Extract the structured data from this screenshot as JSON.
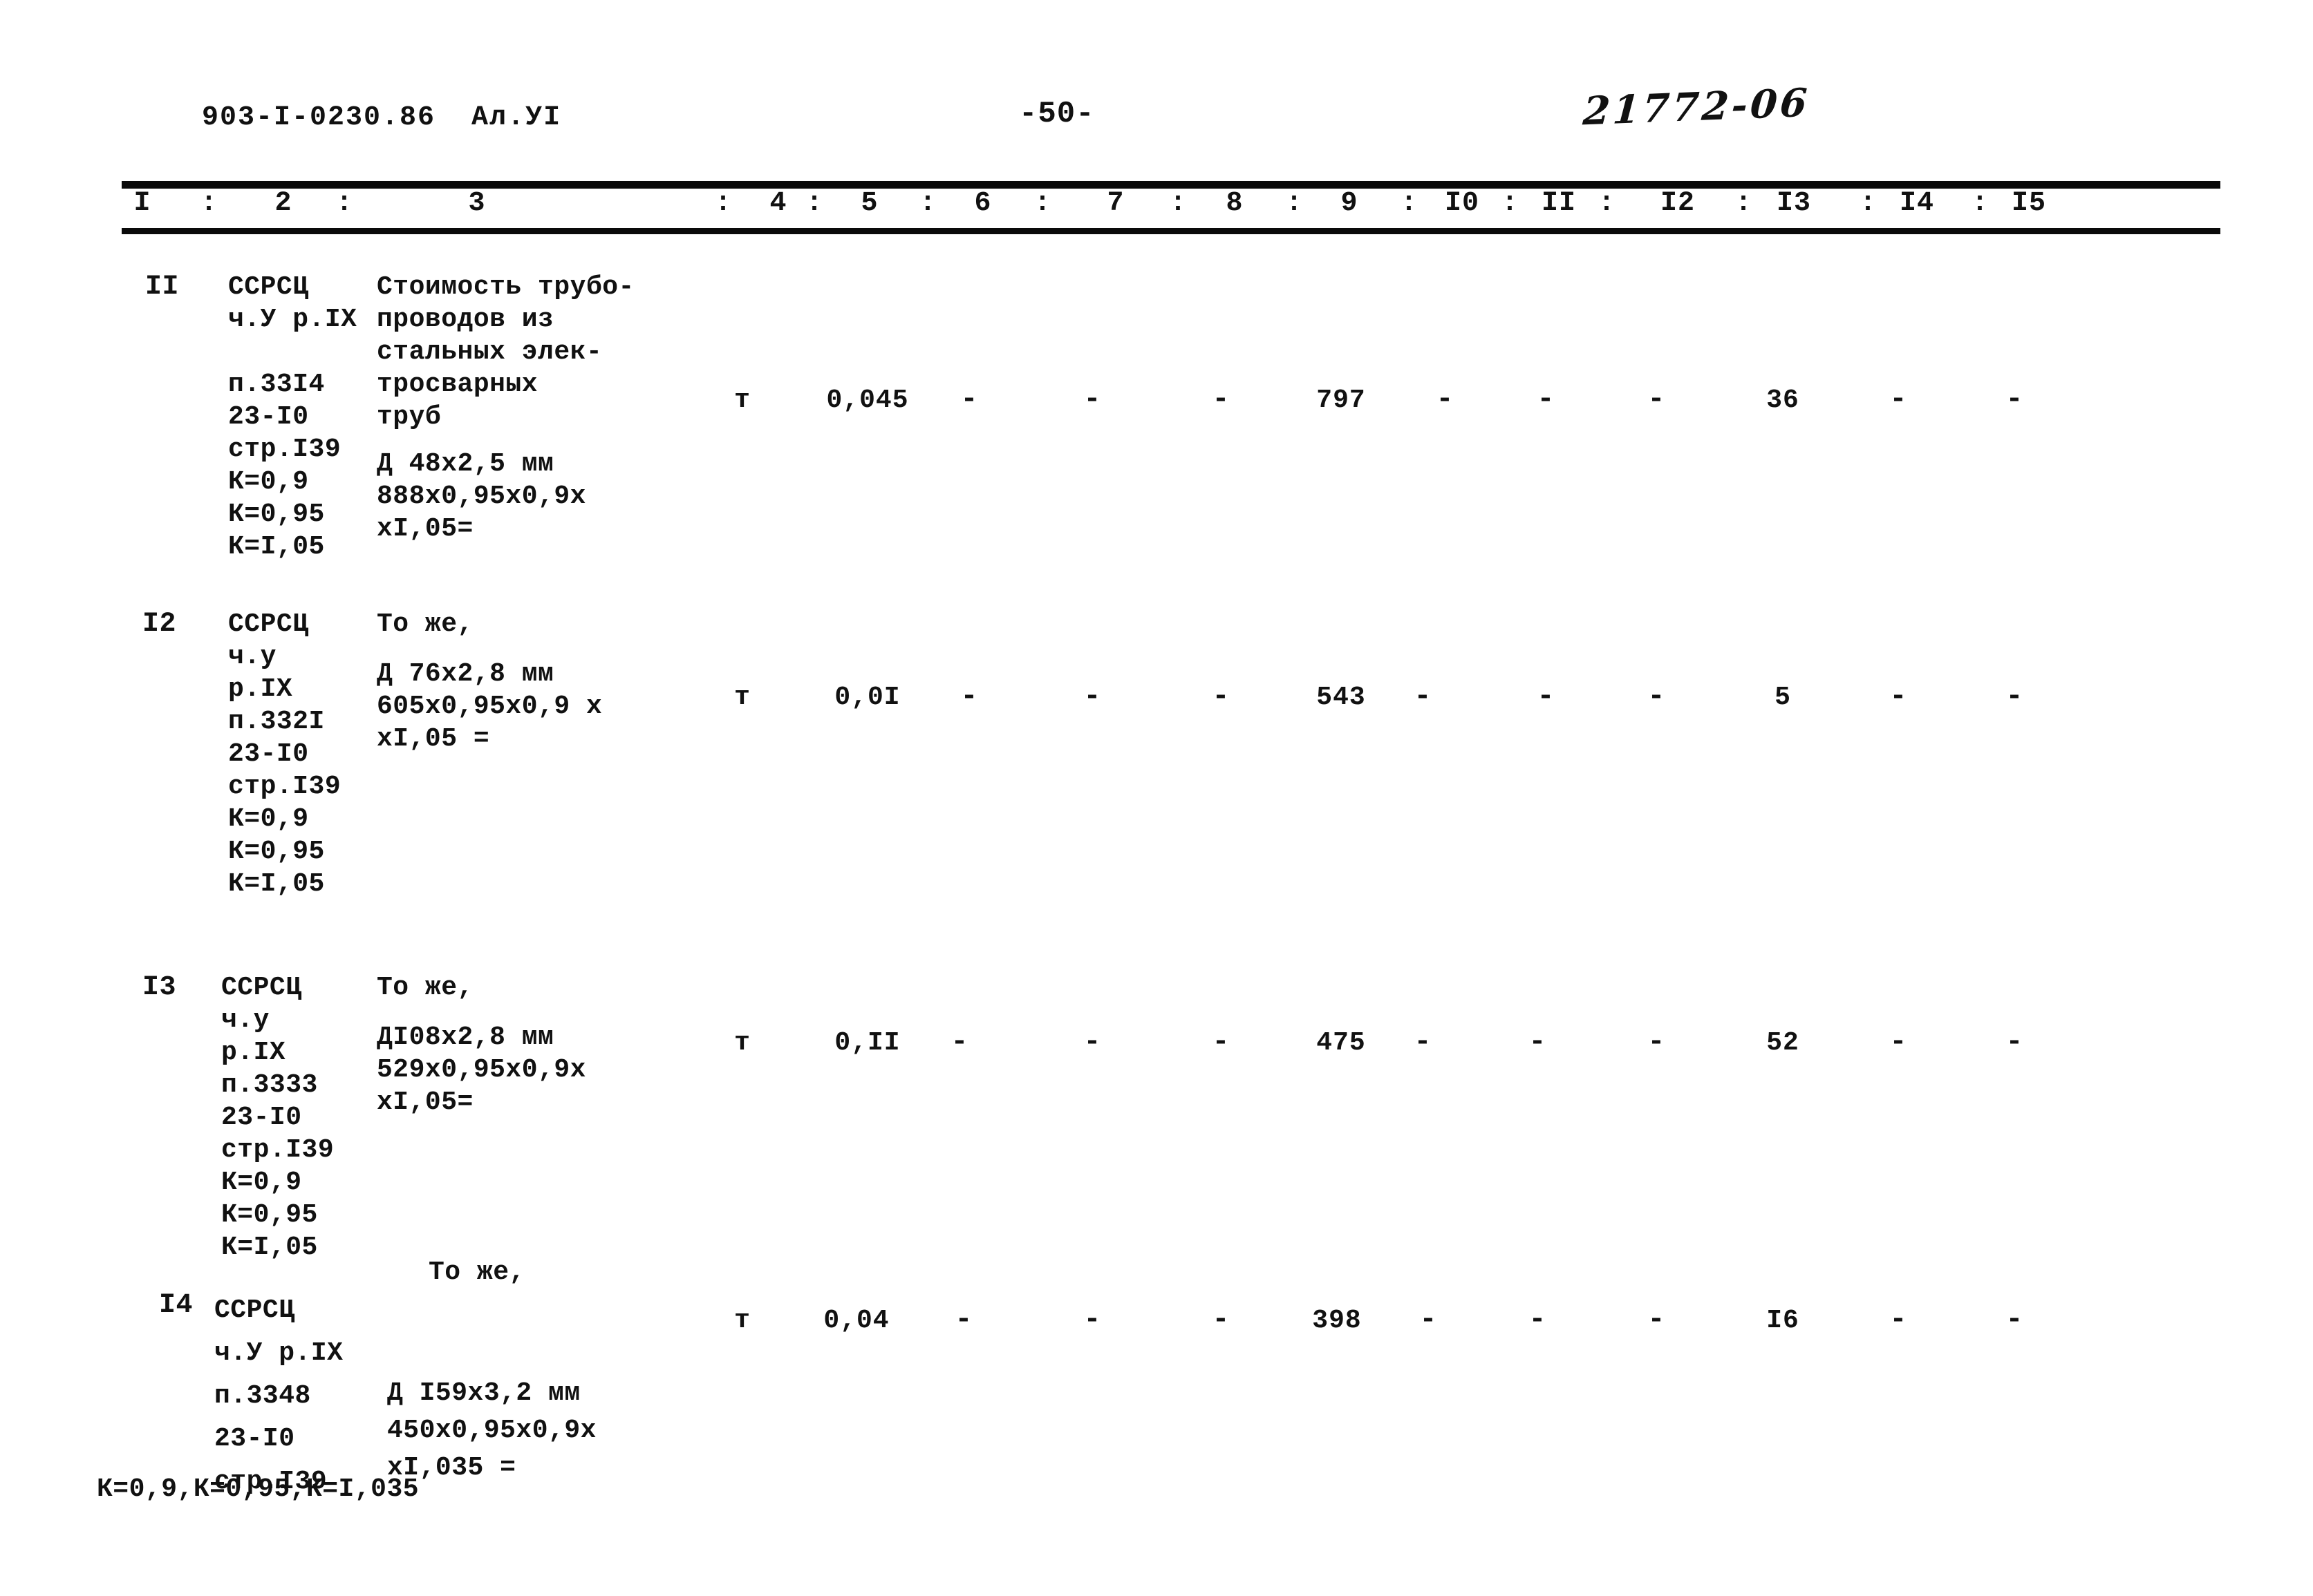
{
  "header": {
    "doc_code": "903-I-0230.86  Ал.УI",
    "page_number": "-50-",
    "handwritten_note": "21772-06"
  },
  "table": {
    "column_headers": [
      "I",
      "2",
      "3",
      "4",
      "5",
      "6",
      "7",
      "8",
      "9",
      "I0",
      "II",
      "I2",
      "I3",
      "I4",
      "I5"
    ],
    "separator": ":",
    "rows": [
      {
        "pos": "II",
        "justification": "ССРСЦ\nч.У р.IX\n\nп.33I4\n23-I0\nстр.I39\nК=0,9\nК=0,95\nК=I,05",
        "description_main": "Стоимость трубо-\nпроводов из\nстальных элек-\nтросварных\nтруб",
        "description_calc": "Д 48х2,5 мм\n888х0,95х0,9х\nхI,05=",
        "unit": "т",
        "qty": "0,045",
        "c6": "-",
        "c7": "-",
        "c8": "-",
        "c9": "797",
        "c10": "-",
        "c11": "-",
        "c12": "-",
        "c13": "36",
        "c14": "-",
        "c15": "-"
      },
      {
        "pos": "I2",
        "justification": "ССРСЦ\nч.у\nр.IX\nп.332I\n23-I0\nстр.I39\nК=0,9\nК=0,95\nК=I,05",
        "description_main": "То же,",
        "description_calc": "Д 76х2,8 мм\n605х0,95х0,9 х\nхI,05 =",
        "unit": "т",
        "qty": "0,0I",
        "c6": "-",
        "c7": "-",
        "c8": "-",
        "c9": "543",
        "c10": "-",
        "c11": "-",
        "c12": "-",
        "c13": "5",
        "c14": "-",
        "c15": "-"
      },
      {
        "pos": "I3",
        "justification": "ССРСЦ\nч.у\nр.IX\nп.3333\n23-I0\nстр.I39\nК=0,9\nК=0,95\nК=I,05",
        "description_main": "То же,",
        "description_calc": "ДI08х2,8 мм\n529х0,95х0,9х\nхI,05=",
        "unit": "т",
        "qty": "0,II",
        "c6": "-",
        "c7": "-",
        "c8": "-",
        "c9": "475",
        "c10": "-",
        "c11": "-",
        "c12": "-",
        "c13": "52",
        "c14": "-",
        "c15": "-"
      },
      {
        "pos": "I4",
        "justification": "ССРСЦ\nч.У р.IX\nп.3348\n23-I0\nстр.I39",
        "justification_last": "К=0,9,К=0,95,К=I,035",
        "description_main": "То же,",
        "description_calc": "Д I59х3,2 мм\n450х0,95х0,9х\nхI,035 =",
        "unit": "т",
        "qty": "0,04",
        "c6": "-",
        "c7": "-",
        "c8": "-",
        "c9": "398",
        "c10": "-",
        "c11": "-",
        "c12": "-",
        "c13": "I6",
        "c14": "-",
        "c15": "-"
      }
    ]
  }
}
